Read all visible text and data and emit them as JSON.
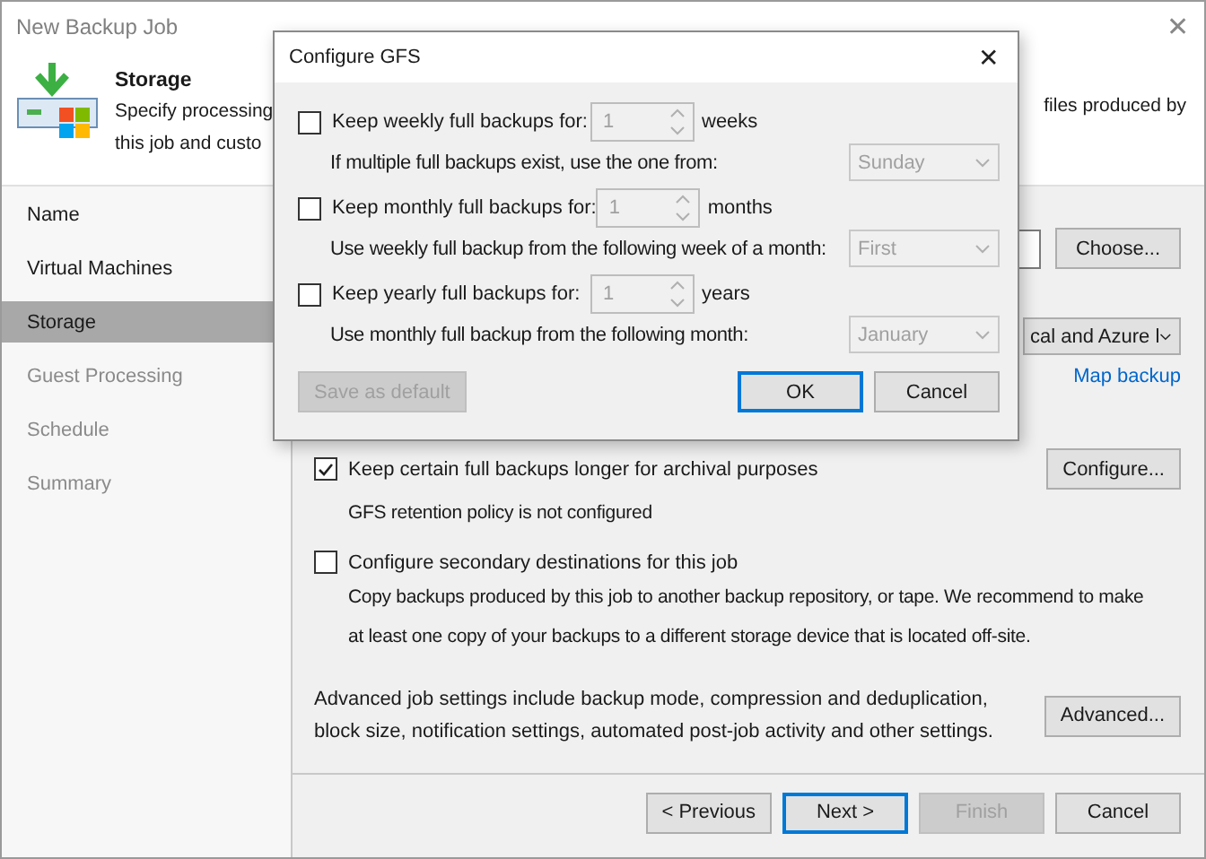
{
  "window": {
    "title": "New Backup Job",
    "close_glyph": "✕"
  },
  "header": {
    "title": "Storage",
    "description_left": [
      "Specify processing",
      "this job and custo"
    ],
    "description_right": "files produced by"
  },
  "sidebar": {
    "items": [
      {
        "label": "Name",
        "selected": false,
        "disabled": false
      },
      {
        "label": "Virtual Machines",
        "selected": false,
        "disabled": false
      },
      {
        "label": "Storage",
        "selected": true,
        "disabled": false
      },
      {
        "label": "Guest Processing",
        "selected": false,
        "disabled": true
      },
      {
        "label": "Schedule",
        "selected": false,
        "disabled": true
      },
      {
        "label": "Summary",
        "selected": false,
        "disabled": true
      }
    ]
  },
  "storage": {
    "choose_button": "Choose...",
    "dropdown_value": "cal and Azure l",
    "map_link": "Map backup"
  },
  "options": [
    {
      "label": "Keep certain full backups longer for archival purposes",
      "checked": true,
      "notes": [
        "GFS retention policy is not configured"
      ],
      "button": "Configure..."
    },
    {
      "label": "Configure secondary destinations for this job",
      "checked": false,
      "notes": [
        "Copy backups produced by this job to another backup repository, or tape. We recommend to make",
        "at least one copy of your backups to a different storage device that is located off-site."
      ]
    }
  ],
  "advanced": {
    "text": "Advanced job settings include backup mode, compression and deduplication, block size, notification settings, automated post-job activity and other settings.",
    "button": "Advanced..."
  },
  "footer": {
    "buttons": [
      {
        "label": "< Previous",
        "disabled": false,
        "default": false
      },
      {
        "label": "Next >",
        "disabled": false,
        "default": true
      },
      {
        "label": "Finish",
        "disabled": true,
        "default": false
      },
      {
        "label": "Cancel",
        "disabled": false,
        "default": false
      }
    ]
  },
  "dialog": {
    "title": "Configure GFS",
    "close_glyph": "✕",
    "options": [
      {
        "label": "Keep weekly full backups for:",
        "checked": false,
        "count": "1",
        "unit": "weeks",
        "sub_label": "If multiple full backups exist, use the one from:",
        "sub_value": "Sunday"
      },
      {
        "label": "Keep monthly full backups for:",
        "checked": false,
        "count": "1",
        "unit": "months",
        "sub_label": "Use weekly full backup from the following week of a month:",
        "sub_value": "First"
      },
      {
        "label": "Keep yearly full backups for:",
        "checked": false,
        "count": "1",
        "unit": "years",
        "sub_label": "Use monthly full backup from the following month:",
        "sub_value": "January"
      }
    ],
    "save_default": {
      "label": "Save as default",
      "disabled": true
    },
    "buttons": [
      {
        "label": "OK",
        "default": true
      },
      {
        "label": "Cancel",
        "default": false
      }
    ]
  }
}
